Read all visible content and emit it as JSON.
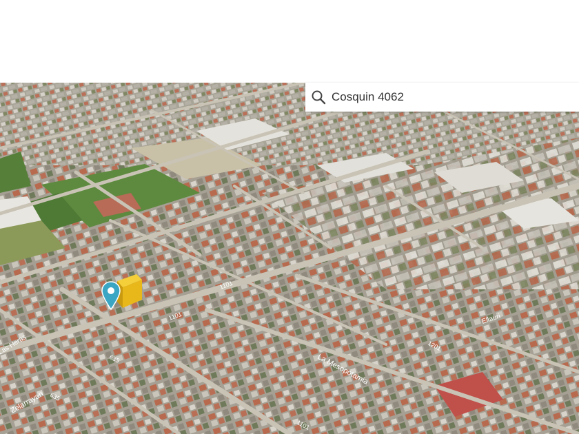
{
  "search": {
    "value": "Cosquin 4062",
    "icon": "search-icon"
  },
  "map": {
    "type": "3d-aerial-satellite",
    "marker": {
      "icon": "location-pin-icon",
      "color": "#3aa6c4"
    },
    "highlighted_property": {
      "color": "#e8b81a"
    },
    "street_labels": [
      "Zelarrayan",
      "La Mesopotamia",
      "Ellauri",
      "Las Heras"
    ],
    "block_numbers": [
      "635",
      "635",
      "1201",
      "1101",
      "1101",
      "1101"
    ]
  }
}
